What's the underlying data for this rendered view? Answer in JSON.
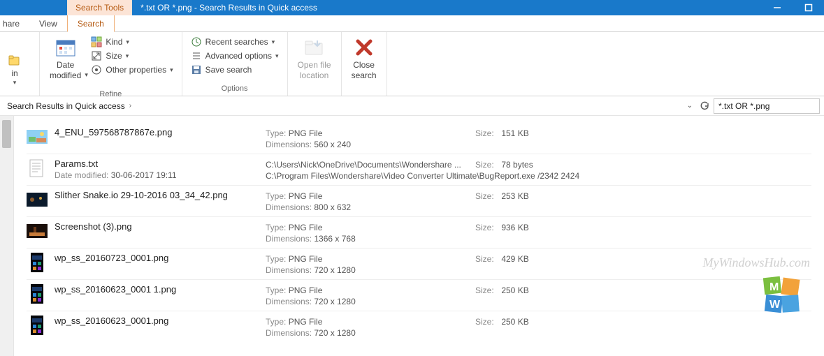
{
  "titlebar": {
    "context_tab": "Search Tools",
    "title": "*.txt OR *.png - Search Results in Quick access"
  },
  "tabs": {
    "hare": "hare",
    "view": "View",
    "search": "Search"
  },
  "ribbon": {
    "date_modified": "Date\nmodified",
    "in": "in",
    "kind": "Kind",
    "size": "Size",
    "other_props": "Other properties",
    "refine_label": "Refine",
    "recent": "Recent searches",
    "advanced": "Advanced options",
    "save": "Save search",
    "options_label": "Options",
    "open_loc": "Open file\nlocation",
    "close_search": "Close\nsearch"
  },
  "breadcrumb": {
    "root": "Search Results in Quick access"
  },
  "search_field": {
    "value": "*.txt OR *.png"
  },
  "labels": {
    "type": "Type:",
    "dimensions": "Dimensions:",
    "size": "Size:",
    "date_modified": "Date modified:"
  },
  "results": [
    {
      "icon": "image-color",
      "name": "4_ENU_597568787867e.png",
      "type": "PNG File",
      "dimensions": "560 x 240",
      "size": "151 KB"
    },
    {
      "icon": "text-doc",
      "name": "Params.txt",
      "date_modified": "30-06-2017 19:11",
      "path1": "C:\\Users\\Nick\\OneDrive\\Documents\\Wondershare ...",
      "path2": "C:\\Program Files\\Wondershare\\Video Converter Ultimate\\BugReport.exe /2342 2424",
      "size": "78 bytes"
    },
    {
      "icon": "image-dark1",
      "name": "Slither Snake.io 29-10-2016 03_34_42.png",
      "type": "PNG File",
      "dimensions": "800 x 632",
      "size": "253 KB"
    },
    {
      "icon": "image-dark2",
      "name": "Screenshot (3).png",
      "type": "PNG File",
      "dimensions": "1366 x 768",
      "size": "936 KB"
    },
    {
      "icon": "image-phone",
      "name": "wp_ss_20160723_0001.png",
      "type": "PNG File",
      "dimensions": "720 x 1280",
      "size": "429 KB"
    },
    {
      "icon": "image-phone",
      "name": "wp_ss_20160623_0001 1.png",
      "type": "PNG File",
      "dimensions": "720 x 1280",
      "size": "250 KB"
    },
    {
      "icon": "image-phone",
      "name": "wp_ss_20160623_0001.png",
      "type": "PNG File",
      "dimensions": "720 x 1280",
      "size": "250 KB"
    }
  ],
  "watermark": "MyWindowsHub.com"
}
